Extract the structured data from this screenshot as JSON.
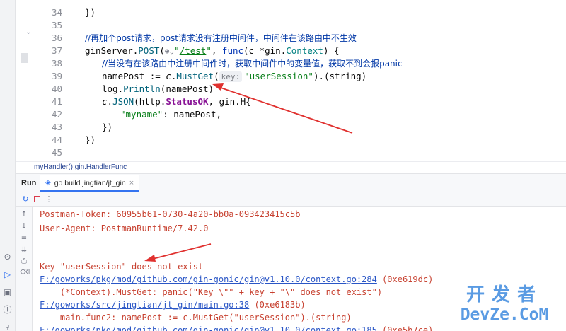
{
  "editor": {
    "line_numbers": [
      "34",
      "35",
      "36",
      "37",
      "38",
      "39",
      "40",
      "41",
      "42",
      "43",
      "44",
      "45"
    ],
    "lines": {
      "l34": "})",
      "l36": "//再加个post请求，post请求没有注册中间件，中间件在该路由中不生效",
      "l37_a": "ginServer.",
      "l37_b": "POST",
      "l37_c": "(",
      "l37_d": "\"",
      "l37_e": "/test",
      "l37_f": "\"",
      "l37_g": ", ",
      "l37_h": "func",
      "l37_i": "(c *gin.",
      "l37_j": "Context",
      "l37_k": ") {",
      "l38": "//当没有在该路由中注册中间件时，获取中间件中的变量值，获取不到会报panic",
      "l39_a": "namePost := ",
      "l39_b": "c",
      "l39_c": ".",
      "l39_d": "MustGet",
      "l39_e": "(",
      "l39_hint": "key:",
      "l39_f": "\"userSession\"",
      "l39_g": ").(string)",
      "l40_a": "log.",
      "l40_b": "Println",
      "l40_c": "(namePost)",
      "l41_a": "c",
      "l41_b": ".",
      "l41_c": "JSON",
      "l41_d": "(http.",
      "l41_e": "StatusOK",
      "l41_f": ", gin.H{",
      "l42_a": "\"myname\"",
      "l42_b": ": namePost,",
      "l43": "})",
      "l44": "})"
    },
    "breadcrumb": "myHandler() gin.HandlerFunc"
  },
  "run": {
    "title": "Run",
    "tab_label": "go build jingtian/jt_gin",
    "tab_close": "×"
  },
  "console": {
    "lines": {
      "c1": "Postman-Token: 60955b61-0730-4a20-bb0a-093423415c5b",
      "c2": "User-Agent: PostmanRuntime/7.42.0",
      "c3": "Key \"userSession\" does not exist",
      "c4_link": "F:/goworks/pkg/mod/github.com/gin-gonic/gin@v1.10.0/context.go:284",
      "c4_addr": " (0xe619dc)",
      "c5": "    (*Context).MustGet: panic(\"Key \\\"\" + key + \"\\\" does not exist\")",
      "c6_link": "F:/goworks/src/jingtian/jt_gin/main.go:38",
      "c6_addr": " (0xe6183b)",
      "c7": "    main.func2: namePost := c.MustGet(\"userSession\").(string)",
      "c8_link": "F:/goworks/pkg/mod/github.com/gin-gonic/gin@v1.10.0/context.go:185",
      "c8_addr": " (0xe5b7ce)"
    }
  },
  "watermark": {
    "cn": "开发者",
    "en": "DevZe.CoM"
  },
  "colors": {
    "arrow": "#e0312f",
    "keyword": "#0033b3",
    "string": "#067d17",
    "console_error": "#c7402f",
    "console_link": "#2a56c6"
  }
}
